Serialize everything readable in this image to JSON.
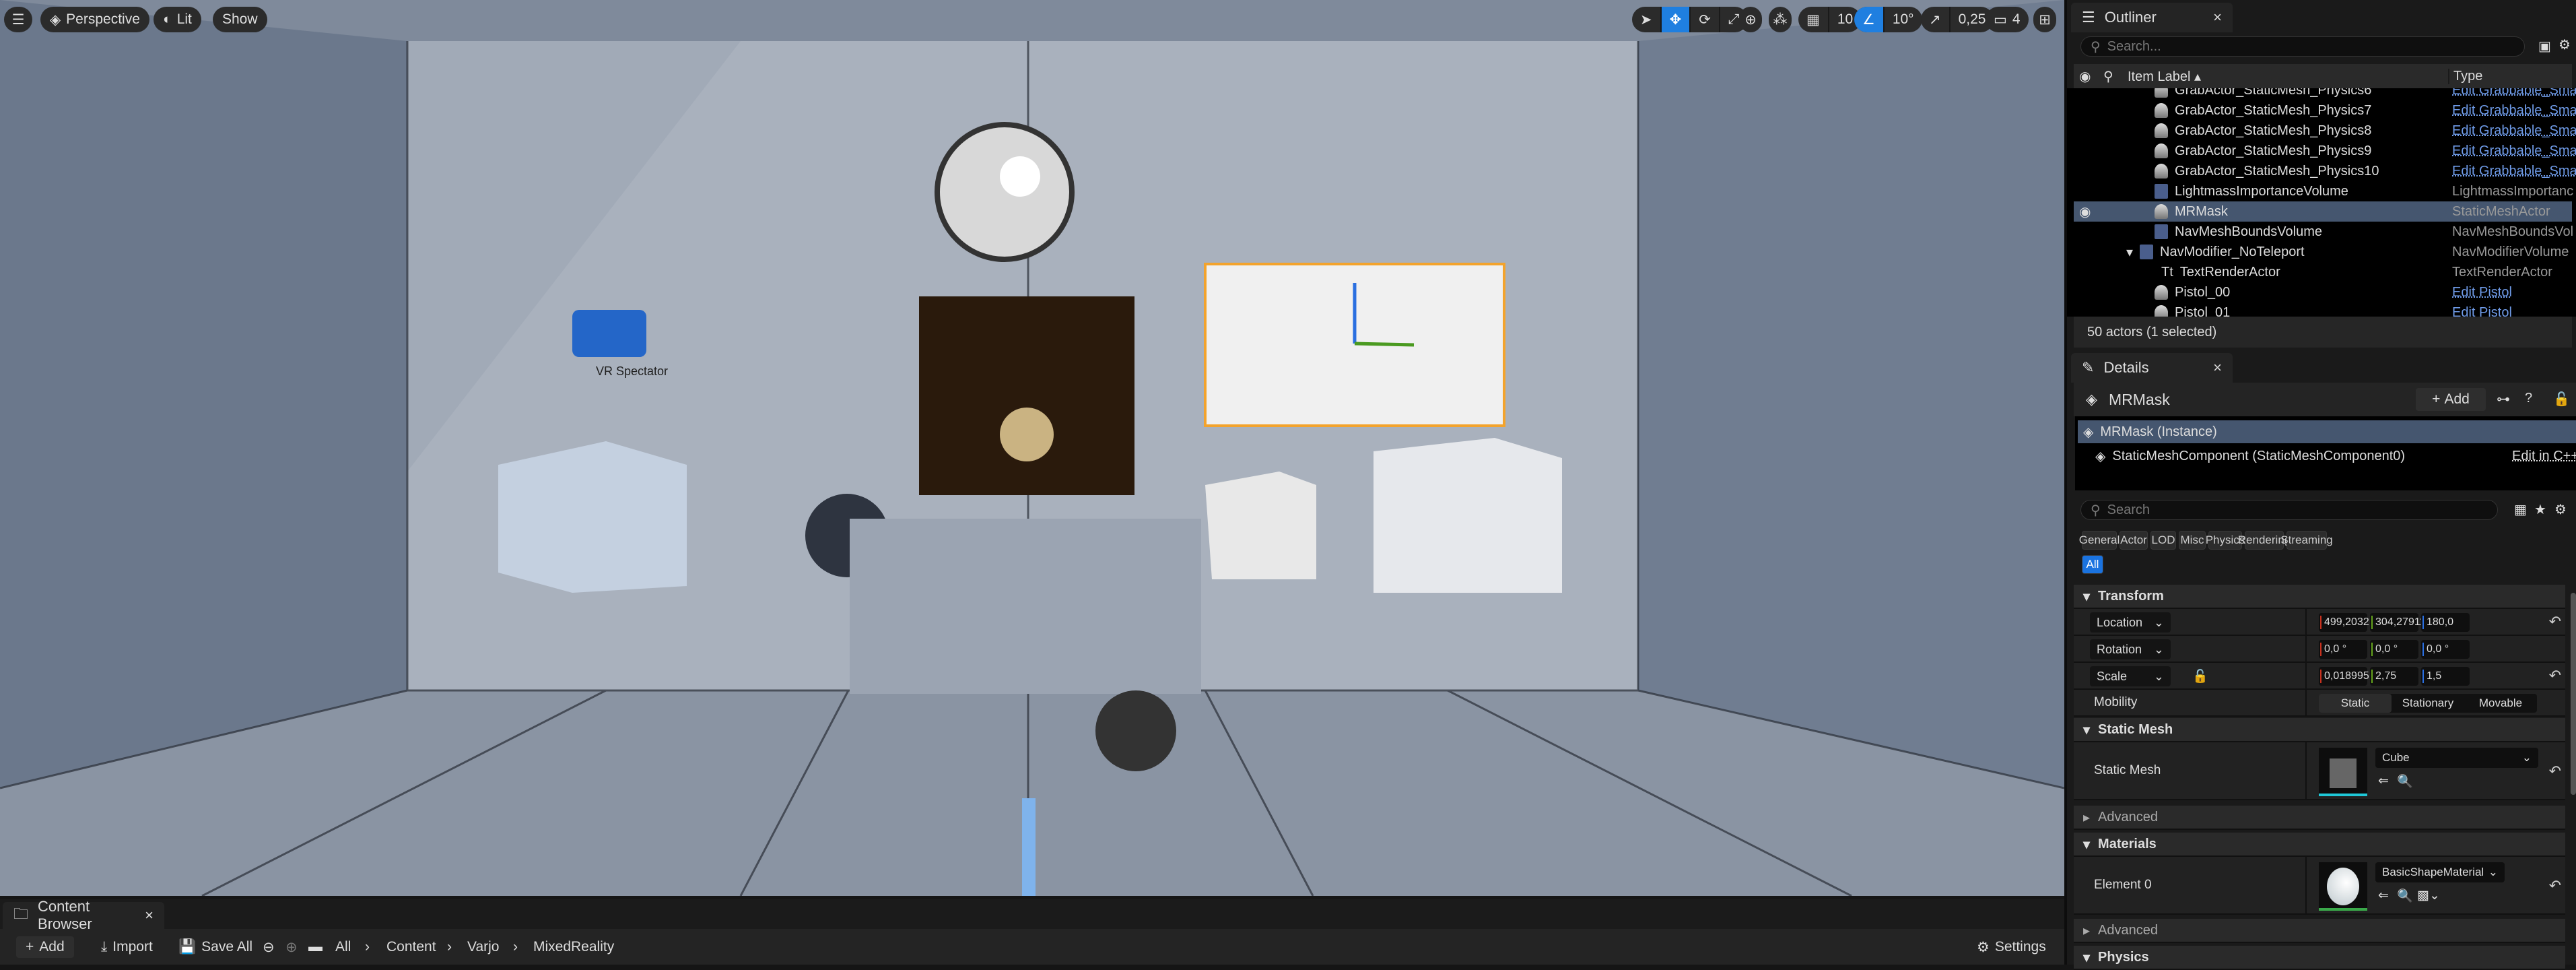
{
  "viewport": {
    "toolbar_left": {
      "menu_icon": "hamburger-icon",
      "perspective": "Perspective",
      "lit": "Lit",
      "show": "Show"
    },
    "toolbar_right": {
      "grid_snap": "10",
      "rotation_snap": "10°",
      "scale_snap": "0,25",
      "camera_speed": "4",
      "active_tool": "translate"
    },
    "scene_labels": {
      "spectator": "VR Spectator"
    }
  },
  "outliner": {
    "tab": "Outliner",
    "search_placeholder": "Search...",
    "columns": {
      "label": "Item Label",
      "type": "Type"
    },
    "items": [
      {
        "label": "GrabActor_StaticMesh_Physics6",
        "type": "Edit Grabbable_Sma",
        "link": true,
        "icon": "actor-icon"
      },
      {
        "label": "GrabActor_StaticMesh_Physics7",
        "type": "Edit Grabbable_Sma",
        "link": true,
        "icon": "actor-icon"
      },
      {
        "label": "GrabActor_StaticMesh_Physics8",
        "type": "Edit Grabbable_Sma",
        "link": true,
        "icon": "actor-icon"
      },
      {
        "label": "GrabActor_StaticMesh_Physics9",
        "type": "Edit Grabbable_Sma",
        "link": true,
        "icon": "actor-icon"
      },
      {
        "label": "GrabActor_StaticMesh_Physics10",
        "type": "Edit Grabbable_Sma",
        "link": true,
        "icon": "actor-icon"
      },
      {
        "label": "LightmassImportanceVolume",
        "type": "LightmassImportanc",
        "link": false,
        "icon": "volume-icon"
      },
      {
        "label": "MRMask",
        "type": "StaticMeshActor",
        "link": false,
        "icon": "static-mesh-icon",
        "selected": true
      },
      {
        "label": "NavMeshBoundsVolume",
        "type": "NavMeshBoundsVol",
        "link": false,
        "icon": "volume-icon"
      },
      {
        "label": "NavModifier_NoTeleport",
        "type": "NavModifierVolume",
        "link": false,
        "icon": "volume-icon"
      },
      {
        "label": "TextRenderActor",
        "type": "TextRenderActor",
        "link": false,
        "icon": "text-icon"
      },
      {
        "label": "Pistol_00",
        "type": "Edit Pistol",
        "link": true,
        "icon": "actor-icon"
      },
      {
        "label": "Pistol_01",
        "type": "Edit Pistol",
        "link": true,
        "icon": "actor-icon"
      }
    ],
    "footer": "50 actors (1 selected)"
  },
  "details": {
    "tab": "Details",
    "actor": "MRMask",
    "add": "Add",
    "components": [
      "MRMask (Instance)",
      "StaticMeshComponent (StaticMeshComponent0)"
    ],
    "edit_cpp": "Edit in C++",
    "search_placeholder": "Search",
    "filters": [
      "General",
      "Actor",
      "LOD",
      "Misc",
      "Physics",
      "Rendering",
      "Streaming",
      "All"
    ],
    "active_filter": "All",
    "transform": {
      "title": "Transform",
      "location": {
        "label": "Location",
        "x": "499,203214",
        "y": "304,279114",
        "z": "180,0"
      },
      "rotation": {
        "label": "Rotation",
        "x": "0,0 °",
        "y": "0,0 °",
        "z": "0,0 °"
      },
      "scale": {
        "label": "Scale",
        "x": "0,018995",
        "y": "2,75",
        "z": "1,5"
      },
      "mobility": {
        "label": "Mobility",
        "options": [
          "Static",
          "Stationary",
          "Movable"
        ],
        "selected": "Static"
      }
    },
    "static_mesh": {
      "title": "Static Mesh",
      "label": "Static Mesh",
      "value": "Cube",
      "advanced": "Advanced"
    },
    "materials": {
      "title": "Materials",
      "label": "Element 0",
      "value": "BasicShapeMaterial",
      "advanced": "Advanced"
    },
    "physics": {
      "title": "Physics"
    }
  },
  "content_browser": {
    "tab": "Content Browser",
    "add": "Add",
    "import": "Import",
    "save_all": "Save All",
    "path": [
      "All",
      "Content",
      "Varjo",
      "MixedReality"
    ],
    "settings": "Settings"
  }
}
